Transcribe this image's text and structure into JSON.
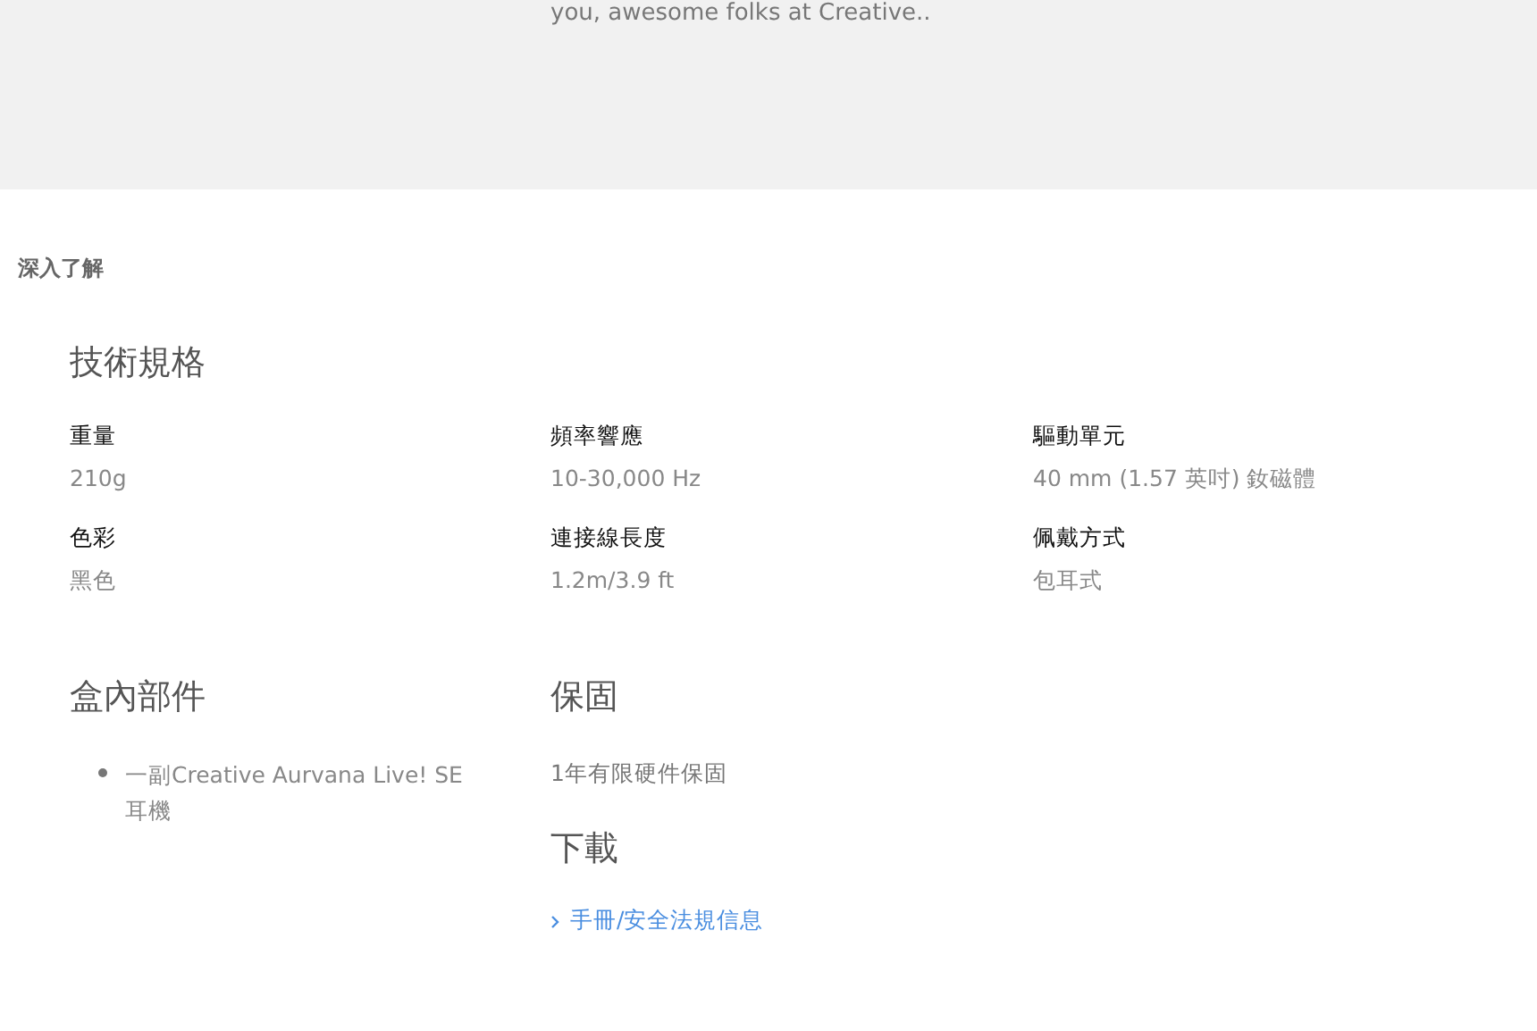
{
  "banner": {
    "text": "you, awesome folks at Creative.."
  },
  "section_title": "深入了解",
  "specs": {
    "heading": "技術規格",
    "items": [
      {
        "label": "重量",
        "value": "210g"
      },
      {
        "label": "頻率響應",
        "value": "10-30,000 Hz"
      },
      {
        "label": "驅動單元",
        "value": "40 mm (1.57 英吋) 釹磁體"
      },
      {
        "label": "色彩",
        "value": "黑色"
      },
      {
        "label": "連接線長度",
        "value": "1.2m/3.9 ft"
      },
      {
        "label": "佩戴方式",
        "value": "包耳式"
      }
    ]
  },
  "in_box": {
    "heading": "盒內部件",
    "items": [
      "一副Creative Aurvana Live!  SE耳機"
    ]
  },
  "warranty": {
    "heading": "保固",
    "text": "1年有限硬件保固"
  },
  "downloads": {
    "heading": "下載",
    "links": [
      "手冊/安全法規信息"
    ]
  }
}
